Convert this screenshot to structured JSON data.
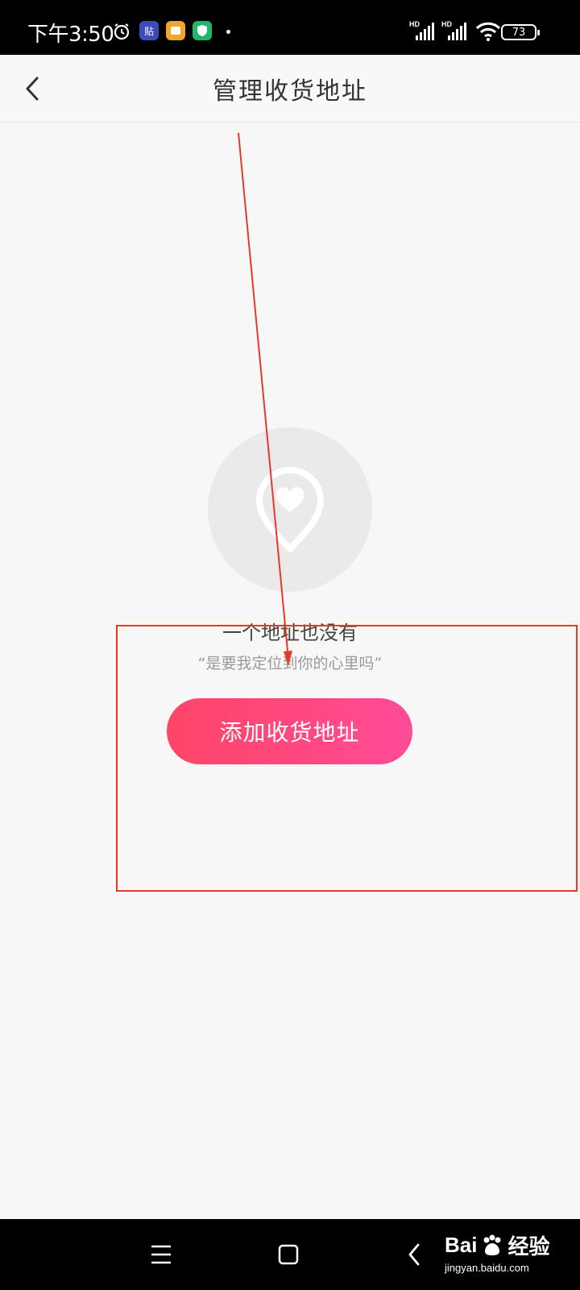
{
  "status_bar": {
    "time": "下午3:50",
    "app_icon_1": "贴",
    "battery": "73",
    "signal_label_1": "HD",
    "signal_label_2": "HD",
    "icons": [
      "alarm-icon",
      "tieba-icon",
      "notes-icon",
      "security-shield-icon",
      "signal-icon",
      "signal-icon",
      "wifi-icon",
      "battery-icon"
    ]
  },
  "header": {
    "title": "管理收货地址",
    "back_icon": "chevron-left-icon"
  },
  "empty_state": {
    "icon": "location-heart-icon",
    "title": "一个地址也没有",
    "subtitle": "“是要我定位到你的心里吗”",
    "button_label": "添加收货地址"
  },
  "colors": {
    "button_gradient_start": "#ff4567",
    "button_gradient_end": "#ff4b97",
    "annotation_red": "#e33a2c",
    "background": "#f7f7f7"
  },
  "nav_bar": {
    "icons": [
      "menu-icon",
      "home-square-icon",
      "back-icon"
    ]
  },
  "watermark": {
    "logo_text_1": "Bai",
    "logo_text_2": "经验",
    "url": "jingyan.baidu.com"
  }
}
